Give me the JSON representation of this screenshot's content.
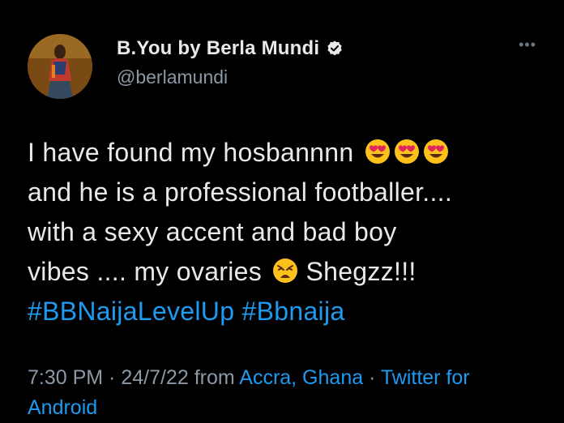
{
  "author": {
    "display_name": "B.You by Berla Mundi",
    "handle": "@berlamundi",
    "verified_icon": "verified-badge-icon",
    "avatar_icon": "profile-avatar"
  },
  "more_label": "•••",
  "tweet": {
    "line1": "I have found my hosbannnn",
    "line2": "and he is a professional footballer....",
    "line3": "with a sexy accent and bad boy",
    "line4a": "vibes .... my ovaries",
    "line4b": "Shegzz!!!",
    "hashtag1": "#BBNaijaLevelUp",
    "hashtag2": "#Bbnaija"
  },
  "meta": {
    "time": "7:30 PM",
    "sep1": " · ",
    "date": "24/7/22",
    "from": " from ",
    "location": "Accra, Ghana",
    "sep2": " · ",
    "source_part1": "Twitter for",
    "source_part2": "Android"
  },
  "colors": {
    "background": "#000000",
    "text": "#e7e9ea",
    "muted": "#8b98a5",
    "link": "#1d9bf0"
  }
}
